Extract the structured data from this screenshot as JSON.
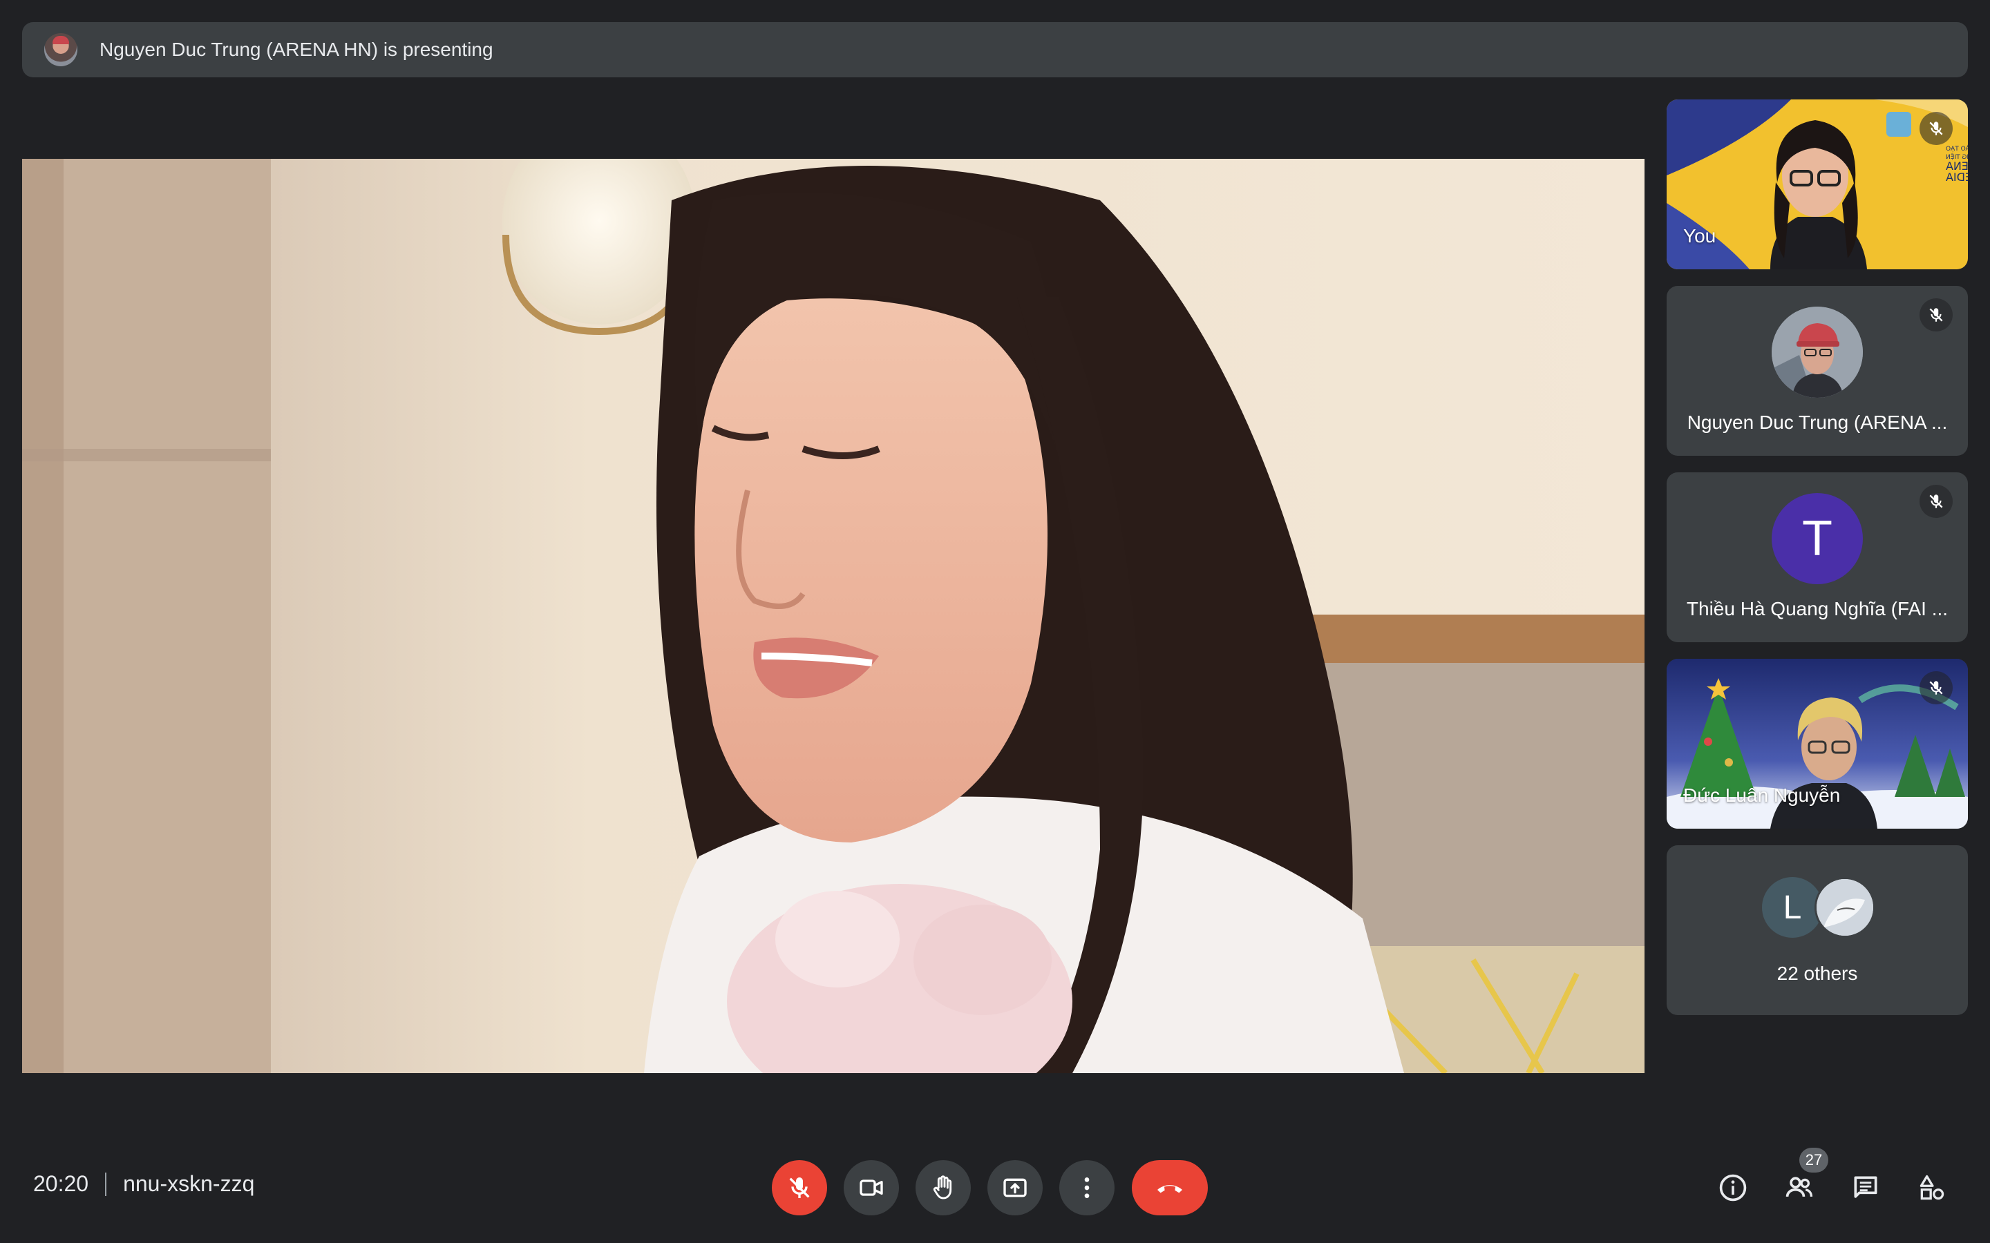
{
  "banner": {
    "text": "Nguyen Duc Trung (ARENA HN) is presenting"
  },
  "participants": [
    {
      "name": "You",
      "mic": "muted",
      "video": "on",
      "background_text": [
        "HỆ THỐNG ĐÀO TẠO",
        "MỸ THUẬT ĐA PHƯƠNG TIỆN",
        "FPT ARENA",
        "MULTIMEDIA"
      ]
    },
    {
      "name": "Nguyen Duc Trung (ARENA ...",
      "mic": "muted",
      "video": "off"
    },
    {
      "name": "Thiều Hà Quang Nghĩa (FAI ...",
      "mic": "muted",
      "video": "off",
      "initial": "T",
      "avatar_color": "#4a2fa8"
    },
    {
      "name": "Đức Luân Nguyễn",
      "mic": "muted",
      "video": "on"
    }
  ],
  "others": {
    "initial": "L",
    "label": "22 others"
  },
  "meeting": {
    "time": "20:20",
    "code": "nnu-xskn-zzq"
  },
  "controls": {
    "mic": "mic-off-icon",
    "camera": "videocam-icon",
    "hand": "raise-hand-icon",
    "present": "present-screen-icon",
    "more": "more-vert-icon",
    "leave": "call-end-icon"
  },
  "side": {
    "people_count": "27"
  },
  "colors": {
    "background": "#202124",
    "surface": "#3c4043",
    "danger": "#ea4335"
  }
}
